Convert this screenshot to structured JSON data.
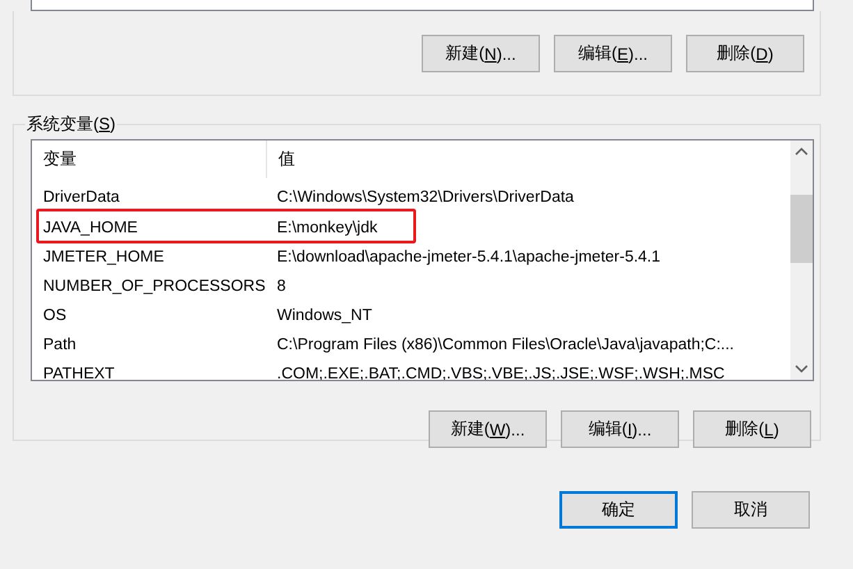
{
  "user_buttons": [
    {
      "before": "新建(",
      "accel": "N",
      "after": ")..."
    },
    {
      "before": "编辑(",
      "accel": "E",
      "after": ")..."
    },
    {
      "before": "删除(",
      "accel": "D",
      "after": ")"
    }
  ],
  "system_variables": {
    "legend": {
      "before": "系统变量(",
      "accel": "S",
      "after": ")"
    },
    "columns": [
      "变量",
      "值"
    ],
    "rows": [
      {
        "name": "DriverData",
        "value": "C:\\Windows\\System32\\Drivers\\DriverData",
        "highlighted": false
      },
      {
        "name": "JAVA_HOME",
        "value": "E:\\monkey\\jdk",
        "highlighted": true
      },
      {
        "name": "JMETER_HOME",
        "value": "E:\\download\\apache-jmeter-5.4.1\\apache-jmeter-5.4.1",
        "highlighted": false
      },
      {
        "name": "NUMBER_OF_PROCESSORS",
        "value": "8",
        "highlighted": false
      },
      {
        "name": "OS",
        "value": "Windows_NT",
        "highlighted": false
      },
      {
        "name": "Path",
        "value": "C:\\Program Files (x86)\\Common Files\\Oracle\\Java\\javapath;C:...",
        "highlighted": false
      },
      {
        "name": "PATHEXT",
        "value": ".COM;.EXE;.BAT;.CMD;.VBS;.VBE;.JS;.JSE;.WSF;.WSH;.MSC",
        "highlighted": false
      }
    ],
    "buttons": [
      {
        "before": "新建(",
        "accel": "W",
        "after": ")..."
      },
      {
        "before": "编辑(",
        "accel": "I",
        "after": ")..."
      },
      {
        "before": "删除(",
        "accel": "L",
        "after": ")"
      }
    ]
  },
  "dialog_buttons": [
    {
      "label": "确定",
      "default": true
    },
    {
      "label": "取消",
      "default": false
    }
  ]
}
